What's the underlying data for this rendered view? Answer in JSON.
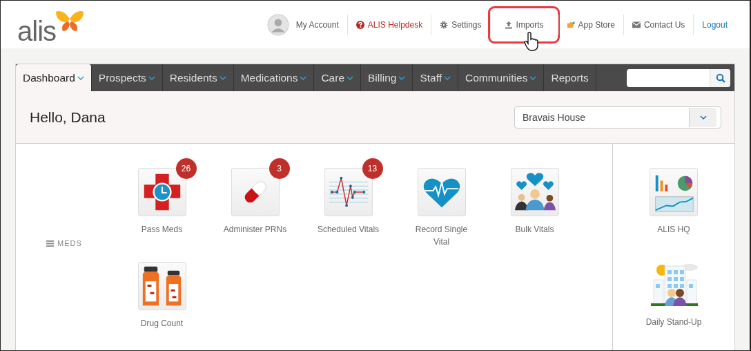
{
  "header": {
    "logo": "alis",
    "links": [
      {
        "kind": "account",
        "label": "My Account",
        "highlighted": false
      },
      {
        "kind": "helpdesk",
        "label": "ALIS Helpdesk",
        "highlighted": false
      },
      {
        "kind": "settings",
        "label": "Settings",
        "highlighted": false
      },
      {
        "kind": "imports",
        "label": "Imports",
        "highlighted": true
      },
      {
        "kind": "appstore",
        "label": "App Store",
        "highlighted": false
      },
      {
        "kind": "contact",
        "label": "Contact Us",
        "highlighted": false
      },
      {
        "kind": "logout",
        "label": "Logout",
        "highlighted": false
      }
    ]
  },
  "tabs": [
    {
      "label": "Dashboard",
      "selected": true,
      "has_menu": true
    },
    {
      "label": "Prospects",
      "selected": false,
      "has_menu": true
    },
    {
      "label": "Residents",
      "selected": false,
      "has_menu": true
    },
    {
      "label": "Medications",
      "selected": false,
      "has_menu": true
    },
    {
      "label": "Care",
      "selected": false,
      "has_menu": true
    },
    {
      "label": "Billing",
      "selected": false,
      "has_menu": true
    },
    {
      "label": "Staff",
      "selected": false,
      "has_menu": true
    },
    {
      "label": "Communities",
      "selected": false,
      "has_menu": true
    },
    {
      "label": "Reports",
      "selected": false,
      "has_menu": false
    }
  ],
  "greeting": "Hello, Dana",
  "community_select": {
    "value": "Bravais House"
  },
  "section": {
    "label": "MEDS",
    "tiles": [
      {
        "kind": "pass_meds",
        "label": "Pass Meds",
        "badge": "26"
      },
      {
        "kind": "prn",
        "label": "Administer PRNs",
        "badge": "3"
      },
      {
        "kind": "scheduled_vitals",
        "label": "Scheduled Vitals",
        "badge": "13"
      },
      {
        "kind": "single_vital",
        "label": "Record Single Vital"
      },
      {
        "kind": "bulk_vitals",
        "label": "Bulk Vitals"
      },
      {
        "kind": "drug_count",
        "label": "Drug Count"
      }
    ]
  },
  "side_tiles": [
    {
      "kind": "hq",
      "label": "ALIS HQ"
    },
    {
      "kind": "standup",
      "label": "Daily Stand-Up"
    }
  ]
}
